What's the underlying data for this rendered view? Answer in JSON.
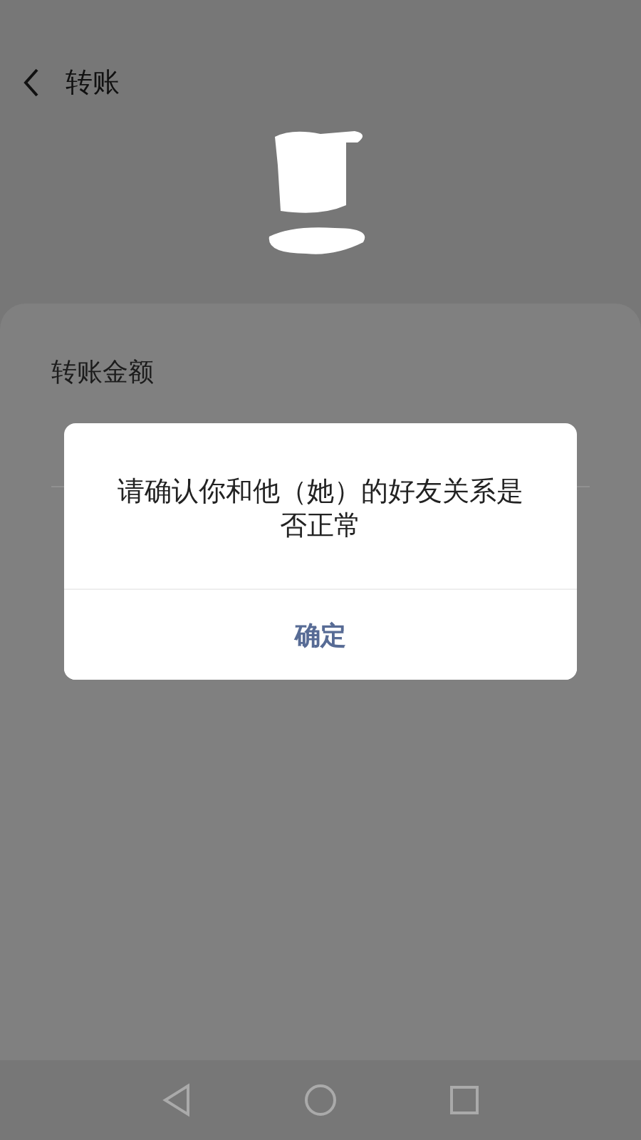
{
  "header": {
    "title": "转账"
  },
  "card": {
    "amount_label": "转账金额"
  },
  "dialog": {
    "message": "请确认你和他（她）的好友关系是否正常",
    "button": "确定"
  }
}
